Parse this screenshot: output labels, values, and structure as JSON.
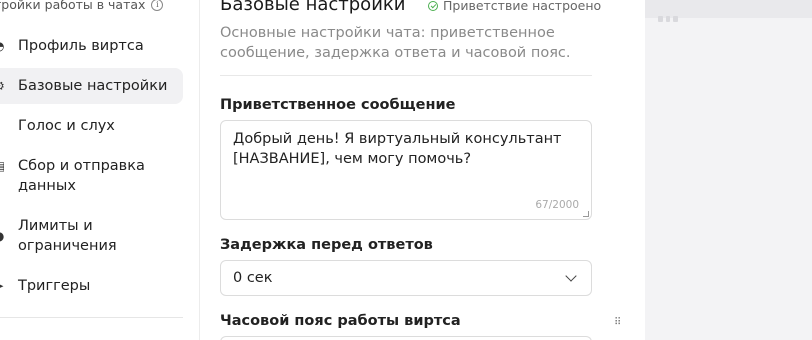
{
  "sidebar": {
    "header": "тройки работы в чатах",
    "items": [
      {
        "label": "Профиль виртса",
        "icon": "profile-icon",
        "active": false
      },
      {
        "label": "Базовые настройки",
        "icon": "settings-icon",
        "active": true
      },
      {
        "label": "Голос и слух",
        "icon": "voice-icon",
        "active": false
      },
      {
        "label": "Сбор и отправка данных",
        "icon": "data-icon",
        "active": false
      },
      {
        "label": "Лимиты и ограничения",
        "icon": "limits-icon",
        "active": false
      },
      {
        "label": "Триггеры",
        "icon": "trigger-icon",
        "active": false
      }
    ]
  },
  "main": {
    "title": "Базовые настройки",
    "status": "Приветствие настроено",
    "description": "Основные настройки чата: приветственное сообщение, задержка ответа и часовой пояс.",
    "greeting": {
      "label": "Приветственное сообщение",
      "value": "Добрый день! Я виртуальный консультант [НАЗВАНИЕ], чем могу помочь?",
      "counter": "67/2000"
    },
    "delay": {
      "label": "Задержка перед ответов",
      "value": "0 сек"
    },
    "timezone": {
      "label": "Часовой пояс работы виртса"
    }
  },
  "colors": {
    "accent_success": "#4caf50",
    "active_bg": "#f1f1f3"
  }
}
